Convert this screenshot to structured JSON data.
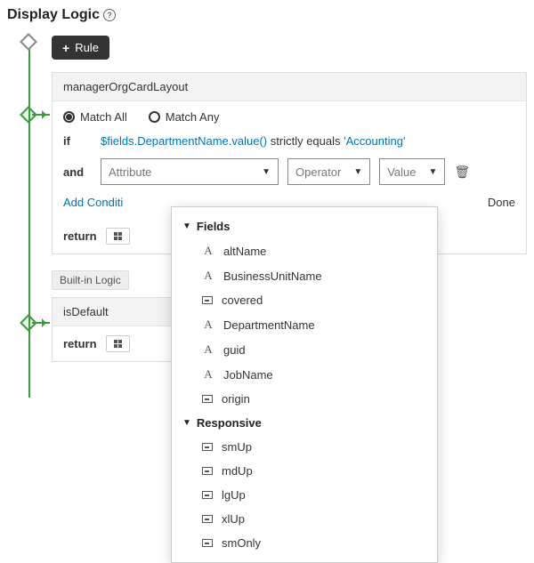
{
  "title": "Display Logic",
  "addRuleLabel": "Rule",
  "card": {
    "name": "managerOrgCardLayout",
    "matchAll": "Match All",
    "matchAny": "Match Any",
    "ifKw": "if",
    "andKw": "and",
    "returnKw": "return",
    "exprField": "$fields.DepartmentName.value()",
    "exprOp": "strictly equals",
    "exprLit": "'Accounting'",
    "attrPlaceholder": "Attribute",
    "operatorLabel": "Operator",
    "valueLabel": "Value",
    "addCondition": "Add Conditi",
    "doneLabel": "Done"
  },
  "builtIn": {
    "pill": "Built-in Logic",
    "isDefault": "isDefault",
    "returnKw": "return"
  },
  "dropdown": {
    "group1": "Fields",
    "group2": "Responsive",
    "fields": [
      "altName",
      "BusinessUnitName",
      "covered",
      "DepartmentName",
      "guid",
      "JobName",
      "origin"
    ],
    "fieldTypes": [
      "A",
      "A",
      "box",
      "A",
      "A",
      "A",
      "box"
    ],
    "responsive": [
      "smUp",
      "mdUp",
      "lgUp",
      "xlUp",
      "smOnly"
    ]
  }
}
